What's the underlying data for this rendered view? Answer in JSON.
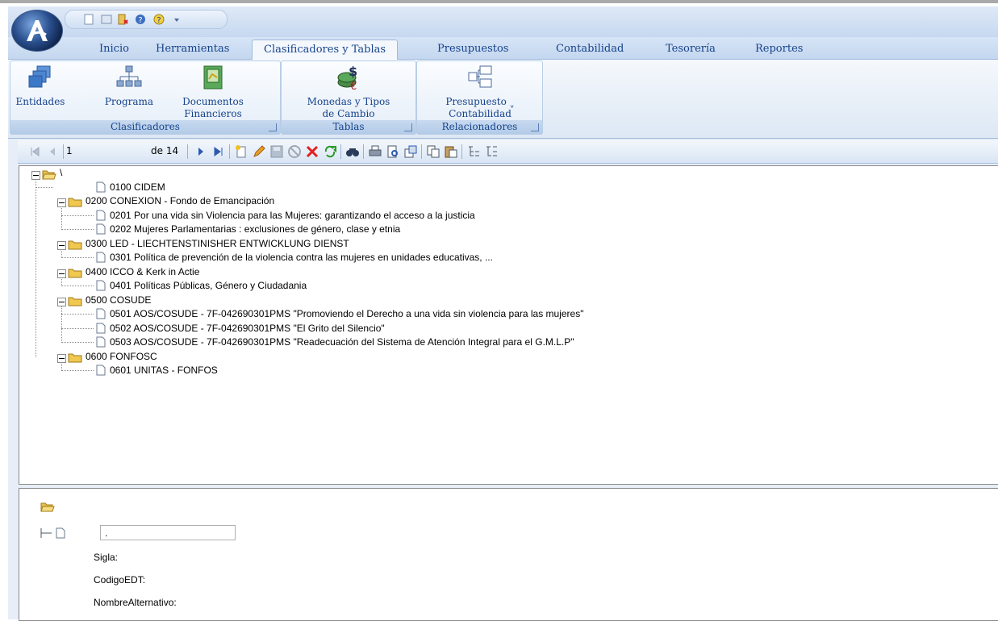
{
  "tabs": [
    {
      "label": "Inicio"
    },
    {
      "label": "Herramientas"
    },
    {
      "label": "Clasificadores y Tablas",
      "active": true
    },
    {
      "label": "Presupuestos"
    },
    {
      "label": "Contabilidad"
    },
    {
      "label": "Tesorería"
    },
    {
      "label": "Reportes"
    }
  ],
  "ribbon": {
    "clasificadores": {
      "label": "Clasificadores",
      "buttons": {
        "entidades": "Entidades",
        "programa": "Programa",
        "documentos_line1": "Documentos",
        "documentos_line2": "Financieros"
      }
    },
    "tablas": {
      "label": "Tablas",
      "buttons": {
        "monedas_line1": "Monedas y Tipos",
        "monedas_line2": "de Cambio"
      }
    },
    "relacionadores": {
      "label": "Relacionadores",
      "buttons": {
        "presupuesto_line1": "Presupuesto",
        "presupuesto_line2": "Contabilidad"
      }
    }
  },
  "navigator": {
    "position": "1",
    "total": "de 14"
  },
  "tree": {
    "root": "\\",
    "nodes": [
      {
        "label": "0100 CIDEM"
      },
      {
        "label": "0200 CONEXION - Fondo de Emancipación",
        "children": [
          {
            "label": "0201 Por una vida sin Violencia para las Mujeres: garantizando el acceso a la justicia"
          },
          {
            "label": "0202 Mujeres Parlamentarias : exclusiones de género, clase y etnia"
          }
        ]
      },
      {
        "label": "0300 LED - LIECHTENSTINISHER ENTWICKLUNG DIENST",
        "children": [
          {
            "label": "0301 Política de prevención de la violencia contra las mujeres en unidades educativas, ..."
          }
        ]
      },
      {
        "label": "0400 ICCO  & Kerk in Actie",
        "children": [
          {
            "label": "0401 Políticas Públicas, Género y Ciudadania"
          }
        ]
      },
      {
        "label": "0500 COSUDE",
        "children": [
          {
            "label": "0501 AOS/COSUDE -  7F-042690301PMS \"Promoviendo el Derecho a una vida sin violencia para las mujeres\""
          },
          {
            "label": "0502 AOS/COSUDE -  7F-042690301PMS \"El Grito del Silencio\""
          },
          {
            "label": "0503 AOS/COSUDE -  7F-042690301PMS \"Readecuación del Sistema de Atención Integral para el G.M.L.P\""
          }
        ]
      },
      {
        "label": "0600 FONFOSC",
        "children": [
          {
            "label": "0601 UNITAS - FONFOS"
          }
        ]
      }
    ]
  },
  "details": {
    "input_value": ".",
    "sigla_label": "Sigla:",
    "codigo_label": "CodigoEDT:",
    "nombre_label": "NombreAlternativo:"
  }
}
